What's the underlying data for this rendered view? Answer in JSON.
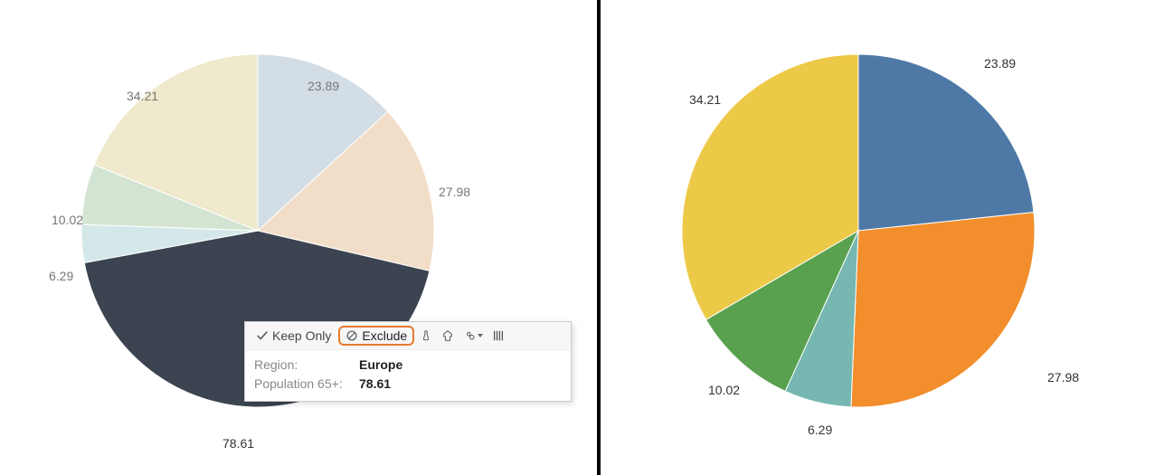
{
  "chart_data": [
    {
      "type": "pie",
      "role": "left (original, selected slice highlighted)",
      "series": [
        {
          "name": "slice-23.89",
          "value": 23.89,
          "label": "23.89",
          "color": "#d3dde6",
          "selected": false
        },
        {
          "name": "slice-27.98",
          "value": 27.98,
          "label": "27.98",
          "color": "#f2ddc8",
          "selected": false
        },
        {
          "name": "Europe",
          "value": 78.61,
          "label": "78.61",
          "color": "#3b4450",
          "selected": true
        },
        {
          "name": "slice-6.29",
          "value": 6.29,
          "label": "6.29",
          "color": "#d4e7e9",
          "selected": false
        },
        {
          "name": "slice-10.02",
          "value": 10.02,
          "label": "10.02",
          "color": "#d3e5d2",
          "selected": false
        },
        {
          "name": "slice-34.21",
          "value": 34.21,
          "label": "34.21",
          "color": "#efe9cd",
          "selected": false
        }
      ]
    },
    {
      "type": "pie",
      "role": "right (after Exclude Europe)",
      "series": [
        {
          "name": "slice-23.89",
          "value": 23.89,
          "label": "23.89",
          "color": "#4e79a7"
        },
        {
          "name": "slice-27.98",
          "value": 27.98,
          "label": "27.98",
          "color": "#f28e2b"
        },
        {
          "name": "slice-6.29",
          "value": 6.29,
          "label": "6.29",
          "color": "#76b7b2"
        },
        {
          "name": "slice-10.02",
          "value": 10.02,
          "label": "10.02",
          "color": "#59a14f"
        },
        {
          "name": "slice-34.21",
          "value": 34.21,
          "label": "34.21",
          "color": "#edc948"
        }
      ]
    }
  ],
  "tooltip": {
    "actions": {
      "keep_only": "Keep Only",
      "exclude": "Exclude"
    },
    "rows": [
      {
        "key": "Region:",
        "value": "Europe"
      },
      {
        "key": "Population 65+:",
        "value": "78.61"
      }
    ]
  },
  "highlight_color": "#e8792d"
}
